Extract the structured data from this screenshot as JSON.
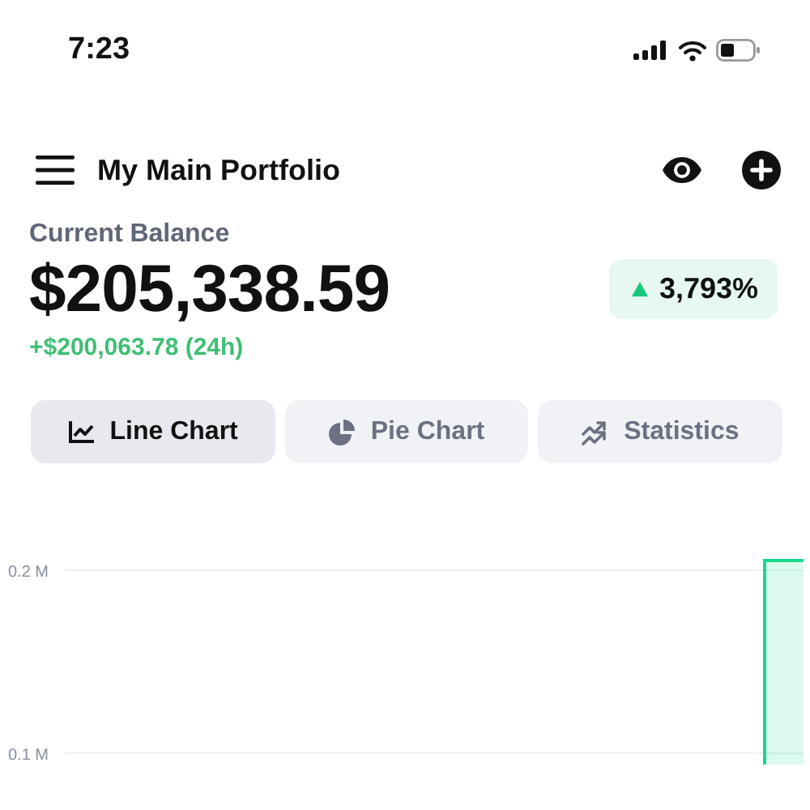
{
  "status_bar": {
    "time": "7:23"
  },
  "header": {
    "title": "My Main Portfolio"
  },
  "balance": {
    "label": "Current Balance",
    "value": "$205,338.59",
    "change_24h": "+$200,063.78 (24h)",
    "percent": "3,793%"
  },
  "tabs": [
    {
      "label": "Line Chart",
      "selected": true
    },
    {
      "label": "Pie Chart",
      "selected": false
    },
    {
      "label": "Statistics",
      "selected": false
    }
  ],
  "chart": {
    "y_axis_labels": [
      "0.2 M",
      "0.1 M"
    ]
  }
}
